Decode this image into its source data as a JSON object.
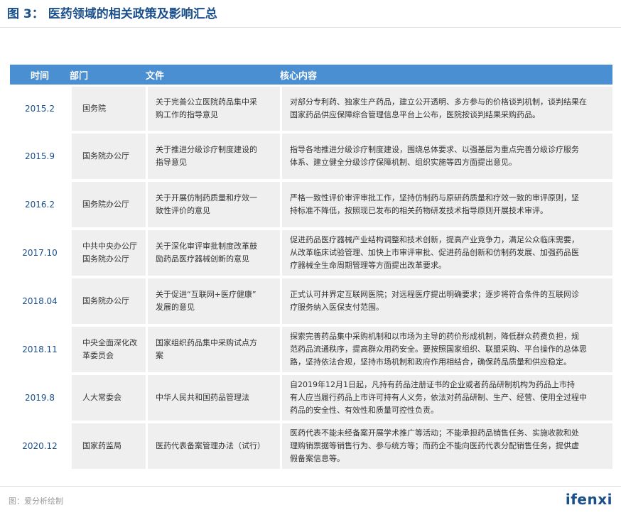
{
  "title": {
    "label": "图 3：",
    "text": "医药领域的相关政策及影响汇总"
  },
  "table": {
    "headers": [
      "时间",
      "部门",
      "文件",
      "核心内容"
    ],
    "rows": [
      {
        "time": "2015.2",
        "dept": "国务院",
        "doc": "关于完善公立医院药品集中采\n购工作的指导意见",
        "core": "对部分专利药、独家生产药品，建立公开透明、多方参与的价格谈判机制，谈判结果在\n国家药品供应保障综合管理信息平台上公布，医院按谈判结果采购药品。"
      },
      {
        "time": "2015.9",
        "dept": "国务院办公厅",
        "doc": "关于推进分级诊疗制度建设的\n指导意见",
        "core": "指导各地推进分级诊疗制度建设，围绕总体要求、以强基层为重点完善分级诊疗服务\n体系、建立健全分级诊疗保障机制、组织实施等四方面提出意见。"
      },
      {
        "time": "2016.2",
        "dept": "国务院办公厅",
        "doc": "关于开展仿制药质量和疗效一\n致性评价的意见",
        "core": "严格一致性评价审评审批工作，坚持仿制药与原研药质量和疗效一致的审评原则，坚\n持标准不降低，按照现已发布的相关药物研发技术指导原则开展技术审评。"
      },
      {
        "time": "2017.10",
        "dept": "中共中央办公厅\n国务院办公厅",
        "doc": "关于深化审评审批制度改革鼓\n励药品医疗器械创新的意见",
        "core": "促进药品医疗器械产业结构调整和技术创新，提高产业竞争力，满足公众临床需要，\n从改革临床试验管理、加快上市审评审批、促进药品创新和仿制药发展、加强药品医\n疗器械全生命周期管理等方面提出改革要求。"
      },
      {
        "time": "2018.04",
        "dept": "国务院办公厅",
        "doc": "关于促进“互联网+医疗健康”\n发展的意见",
        "core": "正式认可并界定互联网医院；对远程医疗提出明确要求；逐步将符合条件的互联网诊\n疗服务纳入医保支付范围。"
      },
      {
        "time": "2018.11",
        "dept": "中央全面深化改\n革委员会",
        "doc": "国家组织药品集中采购试点方\n案",
        "core": "探索完善药品集中采购机制和以市场为主导的药价形成机制，降低群众药费负担，规\n范药品流通秩序，提高群众用药安全。要按照国家组织、联盟采购、平台操作的总体思\n路，坚持依法合规，坚持市场机制和政府作用相结合，确保药品质量和供应稳定。"
      },
      {
        "time": "2019.8",
        "dept": "人大常委会",
        "doc": "中华人民共和国药品管理法",
        "core": "自2019年12月1日起，凡持有药品注册证书的企业或者药品研制机构为药品上市持\n有人应当履行药品上市许可持有人义务，依法对药品研制、生产、经营、使用全过程中\n药品的安全性、有效性和质量可控性负责。"
      },
      {
        "time": "2020.12",
        "dept": "国家药监局",
        "doc": "医药代表备案管理办法（试行）",
        "core": "医药代表不能未经备案开展学术推广等活动；不能承担药品销售任务、实施收款和处\n理购销票据等销售行为、参与统方等；而药企不能向医药代表分配销售任务，提供虚\n假备案信息等。"
      }
    ]
  },
  "footer": {
    "source": "图：爱分析绘制",
    "brand": "ifenxi"
  }
}
